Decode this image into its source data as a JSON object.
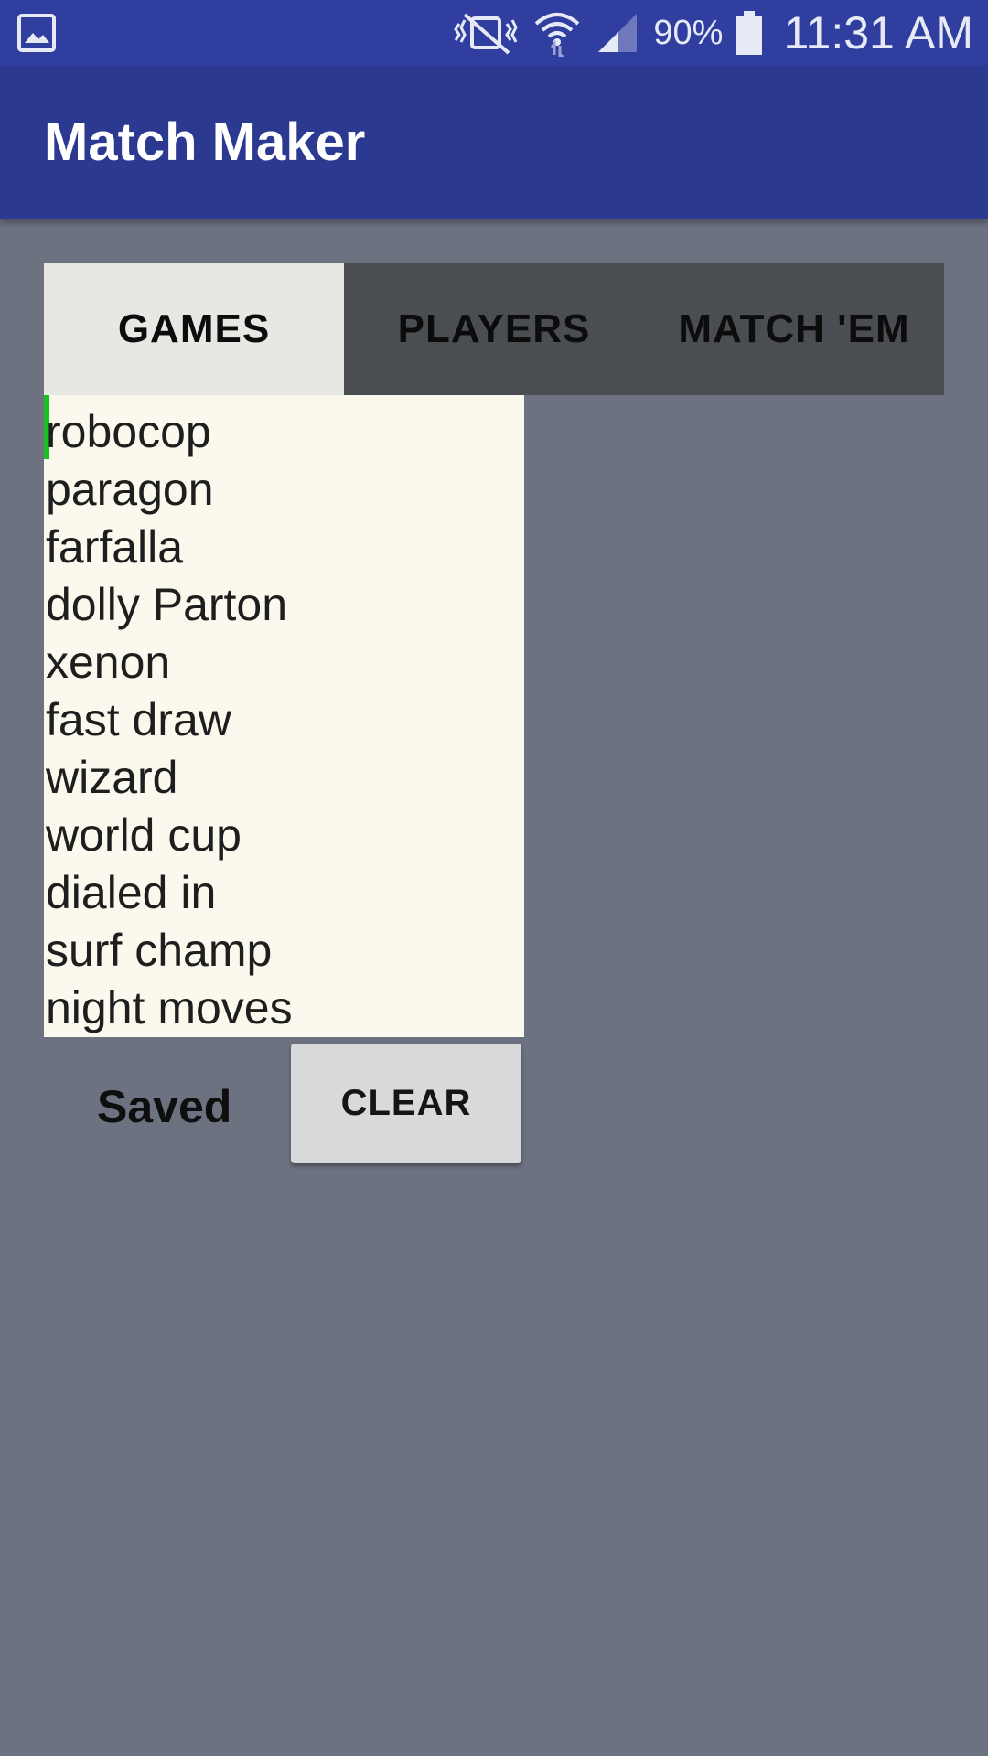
{
  "status_bar": {
    "battery_percent": "90%",
    "time": "11:31 AM",
    "icons": [
      "image-icon",
      "vibrate-mute-icon",
      "wifi-icon",
      "signal-icon",
      "battery-icon"
    ]
  },
  "app_bar": {
    "title": "Match Maker"
  },
  "tabs": [
    {
      "label": "GAMES",
      "active": true
    },
    {
      "label": "PLAYERS",
      "active": false
    },
    {
      "label": "MATCH 'EM",
      "active": false
    }
  ],
  "games_list": {
    "items": [
      "robocop",
      "paragon",
      "farfalla",
      "dolly Parton",
      "xenon",
      "fast draw",
      "wizard",
      "world cup",
      "dialed in",
      "surf champ",
      "night moves"
    ]
  },
  "footer": {
    "status_label": "Saved",
    "clear_label": "CLEAR"
  },
  "colors": {
    "status_bar": "#303f9f",
    "app_bar": "#2c3990",
    "background": "#6c7280",
    "tab_inactive": "#4a4d52",
    "tab_active": "#e7e8e4",
    "list_background": "#fbf9ee",
    "cursor": "#18c21c",
    "button": "#d8d9d9"
  }
}
